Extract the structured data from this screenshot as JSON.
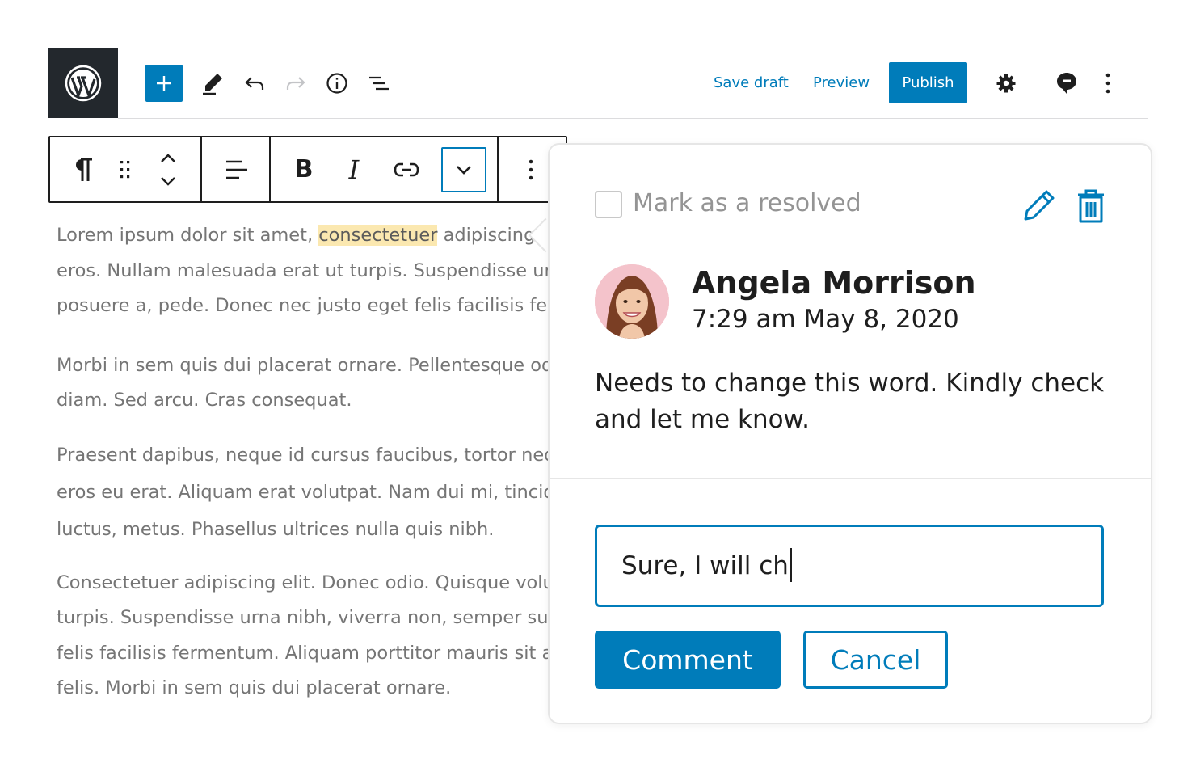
{
  "header": {
    "save_draft": "Save draft",
    "preview": "Preview",
    "publish": "Publish",
    "icons": [
      "wordpress-logo",
      "add-block",
      "pencil",
      "undo",
      "redo",
      "info",
      "list-view",
      "settings",
      "comments",
      "more-vertical"
    ]
  },
  "block_toolbar": {
    "bold": "B",
    "italic": "I",
    "icons": [
      "paragraph",
      "drag-handle",
      "move-up",
      "move-down",
      "align-left",
      "bold",
      "italic",
      "link",
      "chevron-down",
      "more-vertical"
    ]
  },
  "content": {
    "paragraphs": [
      {
        "before": "Lorem ipsum dolor sit amet, ",
        "highlight": "consectetuer",
        "after": " adipiscing elit.",
        "lines": [
          "eros. Nullam malesuada erat ut turpis. Suspendisse urna nibh,",
          "posuere a, pede. Donec nec justo eget felis facilisis fermentum."
        ]
      },
      {
        "lines": [
          "Morbi in sem quis dui placerat ornare. Pellentesque odio nisi,",
          "diam. Sed arcu. Cras consequat."
        ]
      },
      {
        "lines": [
          "Praesent dapibus, neque id cursus faucibus, tortor neque egestas",
          "eros eu erat. Aliquam erat volutpat. Nam dui mi, tincidunt quis,",
          "luctus, metus. Phasellus ultrices nulla quis nibh."
        ]
      },
      {
        "lines": [
          "Consectetuer adipiscing elit. Donec odio. Quisque volutpat mattis",
          "turpis. Suspendisse urna nibh, viverra non, semper suscipit, posuere a,",
          "felis facilisis fermentum. Aliquam porttitor mauris sit amet orci.",
          "felis. Morbi in sem quis dui placerat ornare."
        ]
      }
    ]
  },
  "comment": {
    "resolve_label": "Mark as a resolved",
    "author": "Angela Morrison",
    "date": "7:29 am May 8, 2020",
    "text": "Needs to change this word. Kindly check and let me know.",
    "reply_value": "Sure, I will ch",
    "comment_button": "Comment",
    "cancel_button": "Cancel"
  },
  "colors": {
    "accent": "#007cba",
    "dark": "#23282d",
    "highlight": "#fbe8b0"
  }
}
